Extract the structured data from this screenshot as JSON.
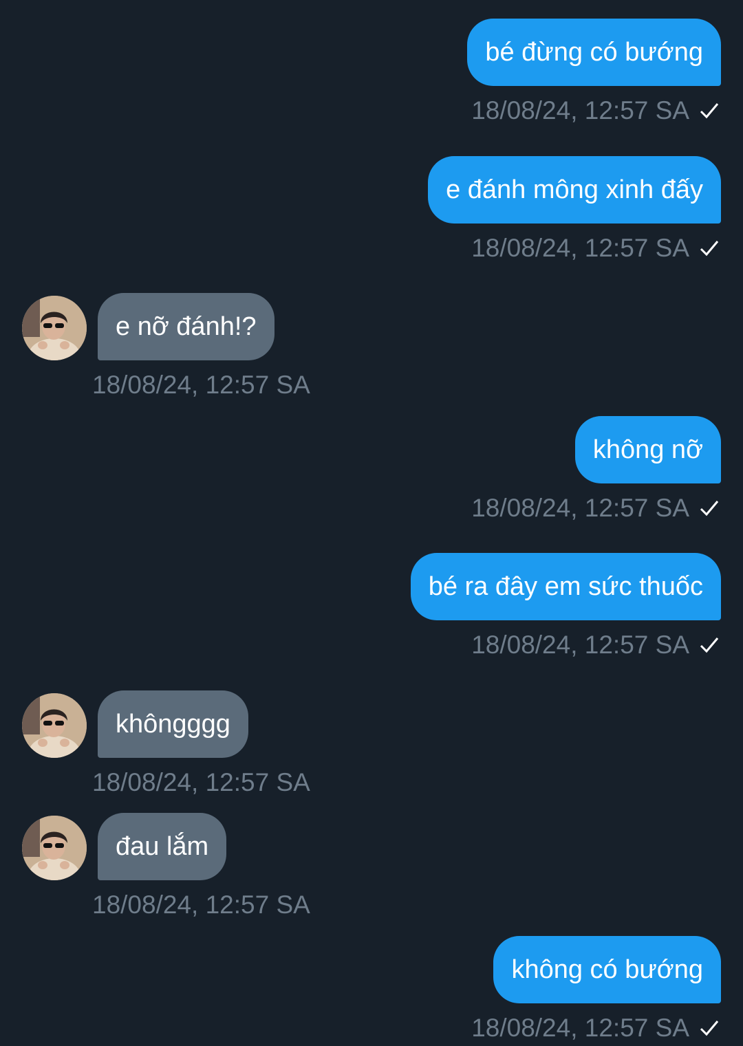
{
  "colors": {
    "background": "#17202a",
    "outgoing_bubble": "#1d9bf0",
    "incoming_bubble": "#5b6b7a",
    "timestamp": "#6f7d8b"
  },
  "icons": {
    "sent_status": "check-icon",
    "contact_photo": "avatar"
  },
  "messages": [
    {
      "direction": "outgoing",
      "text": "bé đừng có bướng",
      "time": "18/08/24, 12:57 SA"
    },
    {
      "direction": "outgoing",
      "text": "e đánh mông xinh đấy",
      "time": "18/08/24, 12:57 SA"
    },
    {
      "direction": "incoming",
      "text": "e nỡ đánh!?",
      "time": "18/08/24, 12:57 SA"
    },
    {
      "direction": "outgoing",
      "text": "không nỡ",
      "time": "18/08/24, 12:57 SA"
    },
    {
      "direction": "outgoing",
      "text": "bé ra đây em sức thuốc",
      "time": "18/08/24, 12:57 SA"
    },
    {
      "direction": "incoming",
      "text": "khôngggg",
      "time": "18/08/24, 12:57 SA"
    },
    {
      "direction": "incoming",
      "text": "đau lắm",
      "time": "18/08/24, 12:57 SA"
    },
    {
      "direction": "outgoing",
      "text": "không có bướng",
      "time": "18/08/24, 12:57 SA"
    }
  ]
}
